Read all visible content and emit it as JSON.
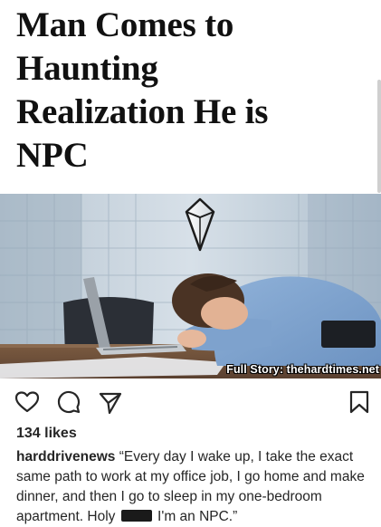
{
  "headline": {
    "lines": [
      "Man Comes to",
      "Haunting",
      "Realization He is",
      "NPC"
    ]
  },
  "photo": {
    "credit": "Full Story: thehardtimes.net",
    "marker_icon": "sims-plumbob-icon"
  },
  "actions": {
    "like_icon": "heart-icon",
    "comment_icon": "comment-icon",
    "share_icon": "send-icon",
    "save_icon": "bookmark-icon"
  },
  "post": {
    "likes": "134 likes",
    "username": "harddrivenews",
    "caption_before": "“Every day I wake up, I take the exact same path to work at my office job, I go home and make dinner, and then I go to sleep in my one-bedroom apartment. Holy",
    "caption_after": "I'm an NPC.”"
  }
}
